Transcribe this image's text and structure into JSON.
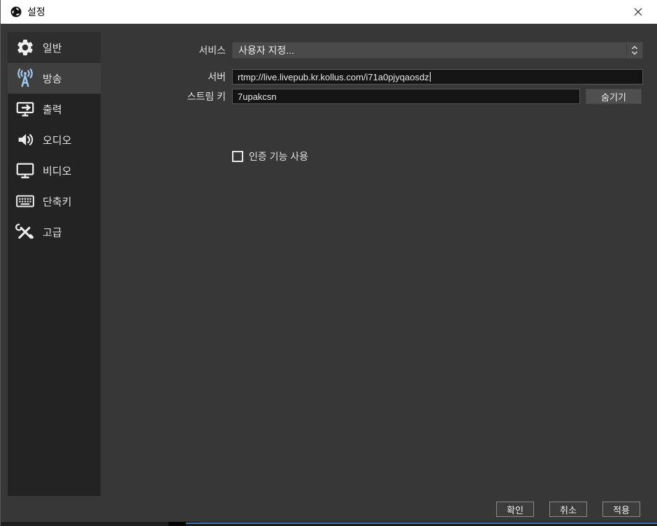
{
  "titlebar": {
    "title": "설정",
    "app_icon": "obs-logo-icon",
    "close_icon": "close-x"
  },
  "sidebar": {
    "items": [
      {
        "label": "일반",
        "icon": "gear-icon",
        "selected": false
      },
      {
        "label": "방송",
        "icon": "broadcast-icon",
        "selected": true
      },
      {
        "label": "출력",
        "icon": "output-icon",
        "selected": false
      },
      {
        "label": "오디오",
        "icon": "audio-icon",
        "selected": false
      },
      {
        "label": "비디오",
        "icon": "video-icon",
        "selected": false
      },
      {
        "label": "단축키",
        "icon": "keyboard-icon",
        "selected": false
      },
      {
        "label": "고급",
        "icon": "tools-icon",
        "selected": false
      }
    ]
  },
  "form": {
    "service": {
      "label": "서비스",
      "value": "사용자 지정..."
    },
    "server": {
      "label": "서버",
      "value": "rtmp://live.livepub.kr.kollus.com/i71a0pjyqaosdz"
    },
    "stream_key": {
      "label": "스트림 키",
      "value": "7upakcsn",
      "hide_button": "숨기기"
    },
    "auth_checkbox": {
      "label": "인증 기능 사용",
      "checked": false
    }
  },
  "footer": {
    "ok": "확인",
    "cancel": "취소",
    "apply": "적용"
  },
  "colors": {
    "titlebar_bg": "#ffffff",
    "dialog_bg": "#373737",
    "sidebar_bg": "#232323",
    "selected_row_bg": "#3f3f3f",
    "selected_icon": "#9fc6ec",
    "input_bg": "#141414",
    "combo_bg": "#4a4a4a",
    "taskbar_blue": "#3e78b8"
  }
}
